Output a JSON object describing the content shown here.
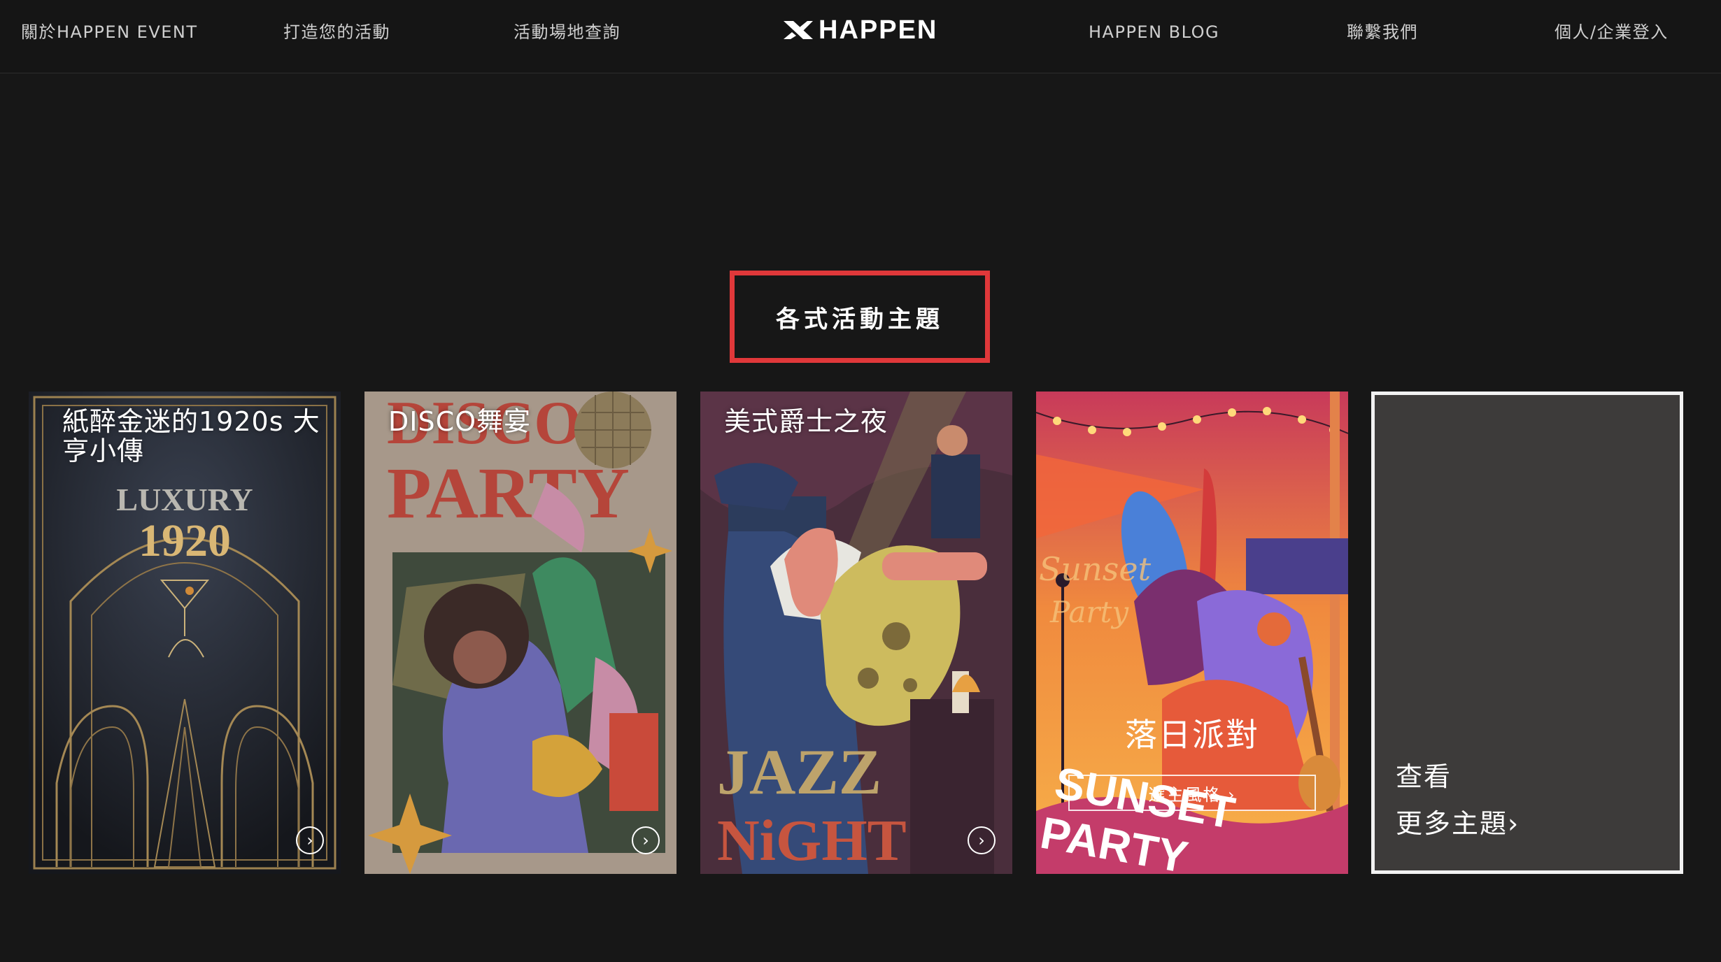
{
  "nav": {
    "left_items": [
      "關於HAPPEN EVENT",
      "打造您的活動",
      "活動場地查詢"
    ],
    "logo_text": "HAPPEN",
    "right_items": [
      "HAPPEN BLOG",
      "聯繫我們",
      "個人/企業登入"
    ]
  },
  "section": {
    "title": "各式活動主題"
  },
  "cards": [
    {
      "title": "紙醉金迷的1920s 大亨小傳",
      "poster_text": [
        "LUXURY",
        "1920"
      ],
      "arrow": "›"
    },
    {
      "title": "DISCO舞宴",
      "poster_text": [
        "DISCO",
        "PARTY"
      ],
      "arrow": "›"
    },
    {
      "title": "美式爵士之夜",
      "poster_text": [
        "JAZZ",
        "NiGHT"
      ],
      "arrow": "›"
    },
    {
      "title": "落日派對",
      "button_label": "選主風格 ›",
      "poster_text": [
        "Sunset",
        "Party",
        "SUNSET",
        "PARTY"
      ]
    }
  ],
  "more": {
    "line1": "查看",
    "line2": "更多主題›"
  },
  "colors": {
    "highlight_border": "#e0383a",
    "background": "#171717",
    "more_card_bg": "#3d3b3a"
  }
}
